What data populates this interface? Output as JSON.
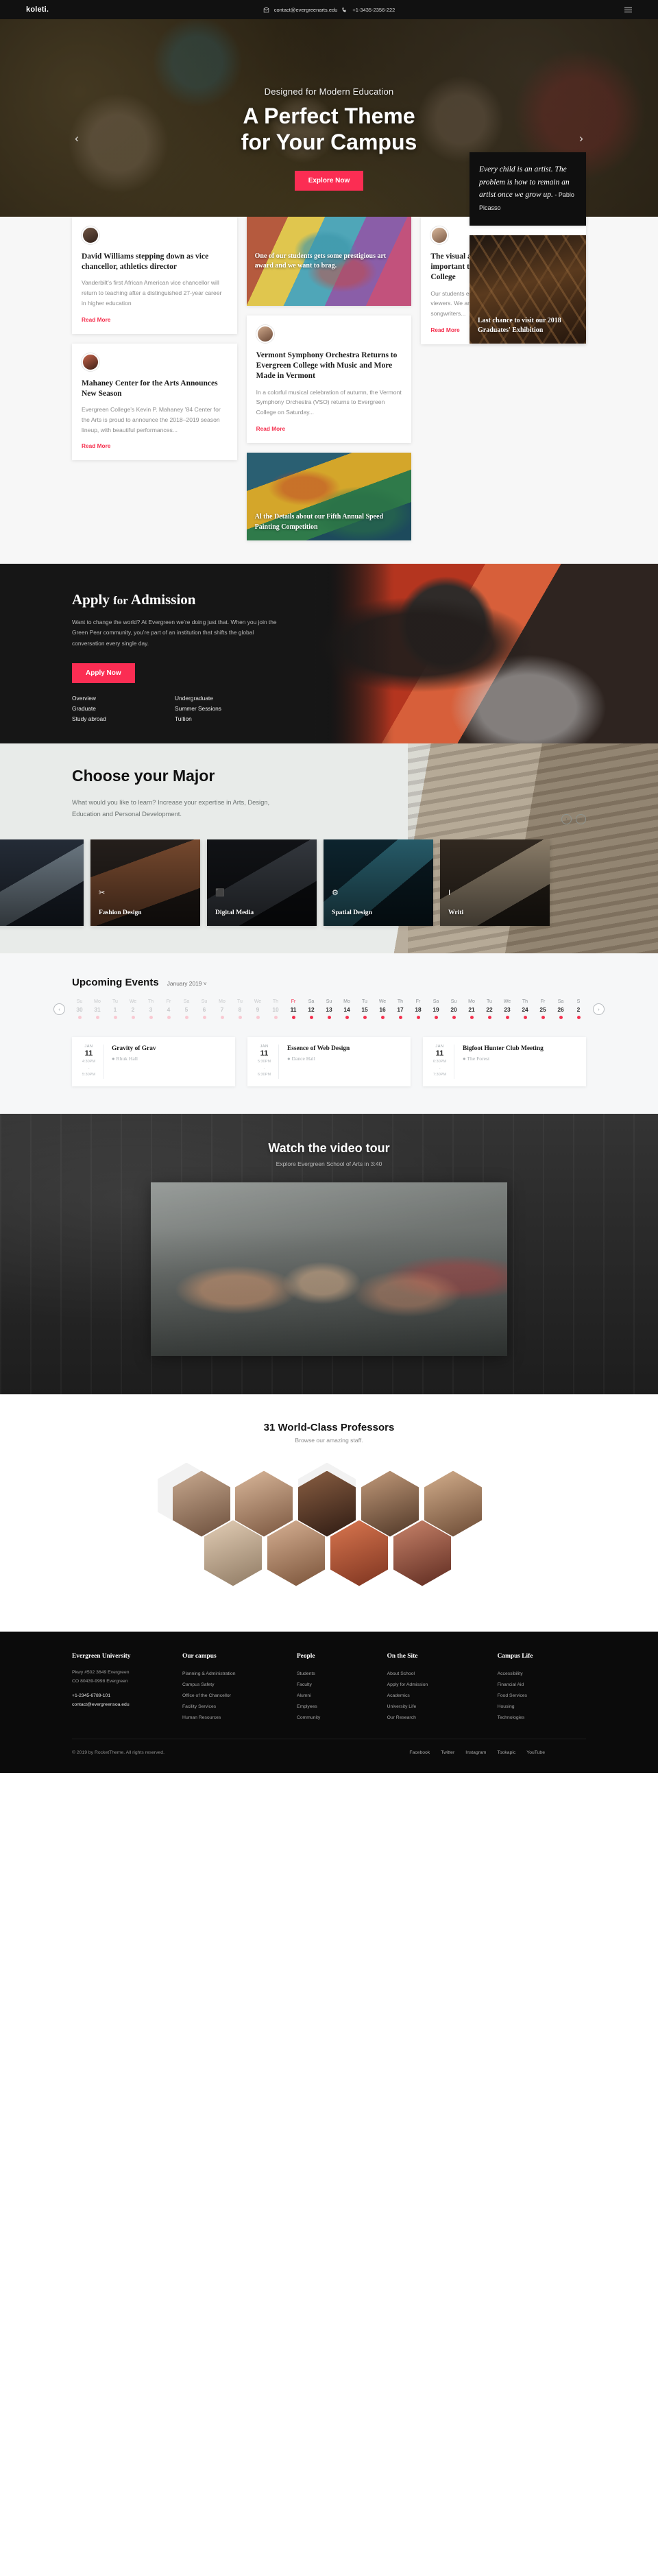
{
  "topbar": {
    "brand": "koleti.",
    "email": "contact@evergreenarts.edu",
    "phone": "+1-3435-2356-222",
    "email_icon": "envelope-icon",
    "phone_icon": "phone-icon",
    "menu_icon": "hamburger-icon"
  },
  "hero": {
    "kicker": "Designed for Modern Education",
    "title_line1": "A Perfect Theme",
    "title_line2": "for Your Campus",
    "cta": "Explore Now",
    "prev": "‹",
    "next": "›"
  },
  "news": {
    "cards": [
      {
        "title": "David Williams stepping down as vice chancellor, athletics director",
        "excerpt": "Vanderbilt’s first African American vice chancellor will return to teaching after a distinguished 27-year career in higher education",
        "link": "Read More"
      },
      {
        "title": "Mahaney Center for the Arts Announces New Season",
        "excerpt": "Evergreen College’s Kevin P. Mahaney ’84 Center for the Arts is proud to announce the 2018–2019 season lineup, with beautiful performances...",
        "link": "Read More"
      },
      {
        "title": "The visual arts are fundamentally important to the life and culture of our College",
        "excerpt": "Our students engage with the arts as both creators and viewers. We are painters and sculptors, actors and songwriters...",
        "link": "Read More"
      },
      {
        "title": "Vermont Symphony Orchestra Returns to Evergreen College with Music and More Made in Vermont",
        "excerpt": "In a colorful musical celebration of autumn, the Vermont Symphony Orchestra (VSO) returns to Evergreen College on Saturday...",
        "link": "Read More"
      }
    ],
    "image_cards": [
      {
        "caption": "One of our students gets some prestigious art award and we want to brag."
      },
      {
        "caption": "Al the Details about our Fifth Annual Speed Painting Competition"
      },
      {
        "caption": "Last chance to visit our 2018 Graduates' Exhibition"
      }
    ],
    "quote": {
      "text": "Every child is an artist. The problem is how to remain an artist once we grow up.",
      "author": " - Pablo Picasso"
    }
  },
  "admission": {
    "title_a": "Apply",
    "title_for": "for",
    "title_b": "Admission",
    "body": "Want to change the world? At Evergreen we’re doing just that. When you join the Green Pear community, you’re part of an institution that shifts the global conversation every single day.",
    "cta": "Apply Now",
    "links": [
      "Overview",
      "Undergraduate",
      "Graduate",
      "Summer Sessions",
      "Study abroad",
      "Tuition"
    ]
  },
  "majors": {
    "title": "Choose your Major",
    "subtitle": "What would you like to learn? Increase your expertise in Arts, Design, Education and Personal Development.",
    "prev": "‹",
    "next": "›",
    "items": [
      {
        "label": "",
        "icon": "palette-icon",
        "glyph": ""
      },
      {
        "label": "Fashion Design",
        "icon": "scissors-icon",
        "glyph": "✂"
      },
      {
        "label": "Digital Media",
        "icon": "monitor-icon",
        "glyph": "⬛"
      },
      {
        "label": "Spatial Design",
        "icon": "compass-icon",
        "glyph": "⚙"
      },
      {
        "label": "Writi",
        "icon": "text-cursor-icon",
        "glyph": "I"
      }
    ]
  },
  "events": {
    "title": "Upcoming Events",
    "month": "January 2019",
    "month_caret": "˅",
    "prev": "‹",
    "next": "›",
    "calendar": [
      {
        "dow": "Su",
        "num": "30",
        "state": "off"
      },
      {
        "dow": "Mo",
        "num": "31",
        "state": "off"
      },
      {
        "dow": "Tu",
        "num": "1",
        "state": "off"
      },
      {
        "dow": "We",
        "num": "2",
        "state": "off"
      },
      {
        "dow": "Th",
        "num": "3",
        "state": "off"
      },
      {
        "dow": "Fr",
        "num": "4",
        "state": "off"
      },
      {
        "dow": "Sa",
        "num": "5",
        "state": "off"
      },
      {
        "dow": "Su",
        "num": "6",
        "state": "off"
      },
      {
        "dow": "Mo",
        "num": "7",
        "state": "off"
      },
      {
        "dow": "Tu",
        "num": "8",
        "state": "off"
      },
      {
        "dow": "We",
        "num": "9",
        "state": "off"
      },
      {
        "dow": "Th",
        "num": "10",
        "state": "off"
      },
      {
        "dow": "Fr",
        "num": "11",
        "state": "active"
      },
      {
        "dow": "Sa",
        "num": "12",
        "state": "on"
      },
      {
        "dow": "Su",
        "num": "13",
        "state": "on"
      },
      {
        "dow": "Mo",
        "num": "14",
        "state": "on"
      },
      {
        "dow": "Tu",
        "num": "15",
        "state": "on"
      },
      {
        "dow": "We",
        "num": "16",
        "state": "on"
      },
      {
        "dow": "Th",
        "num": "17",
        "state": "on"
      },
      {
        "dow": "Fr",
        "num": "18",
        "state": "on"
      },
      {
        "dow": "Sa",
        "num": "19",
        "state": "on"
      },
      {
        "dow": "Su",
        "num": "20",
        "state": "on"
      },
      {
        "dow": "Mo",
        "num": "21",
        "state": "on"
      },
      {
        "dow": "Tu",
        "num": "22",
        "state": "on"
      },
      {
        "dow": "We",
        "num": "23",
        "state": "on"
      },
      {
        "dow": "Th",
        "num": "24",
        "state": "on"
      },
      {
        "dow": "Fr",
        "num": "25",
        "state": "on"
      },
      {
        "dow": "Sa",
        "num": "26",
        "state": "on"
      },
      {
        "dow": "S",
        "num": "2",
        "state": "on"
      }
    ],
    "cards": [
      {
        "month": "JAN",
        "day": "11",
        "start": "4:30PM",
        "dash": "-",
        "end": "5:30PM",
        "title": "Gravity of Grav",
        "location": "Rhuk Hall",
        "pin": "☉"
      },
      {
        "month": "JAN",
        "day": "11",
        "start": "5:30PM",
        "dash": "-",
        "end": "6:30PM",
        "title": "Essence of Web Design",
        "location": "Dance Hall",
        "pin": "☉"
      },
      {
        "month": "JAN",
        "day": "11",
        "start": "6:30PM",
        "dash": "-",
        "end": "7:30PM",
        "title": "Bigfoot Hunter Club Meeting",
        "location": "The Forest",
        "pin": "☉"
      }
    ]
  },
  "video": {
    "title": "Watch the video tour",
    "subtitle": "Explore Evergreen School of Arts in 3:40"
  },
  "professors": {
    "title": "31 World-Class Professors",
    "subtitle": "Browse our amazing staff."
  },
  "footer": {
    "columns": [
      {
        "heading": "Evergreen University",
        "address": "Pkwy #502 3649 Evergreen\nCO 80439-9998 Evergreen",
        "phone": "+1-2345-6789-101",
        "email": "contact@evergreensoa.edu",
        "items": []
      },
      {
        "heading": "Our campus",
        "items": [
          "Planning & Administration",
          "Campus Safety",
          "Office of the Chancellor",
          "Facility Services",
          "Human Resources"
        ]
      },
      {
        "heading": "People",
        "items": [
          "Students",
          "Faculty",
          "Alumni",
          "Emplyees",
          "Community"
        ]
      },
      {
        "heading": "On the Site",
        "items": [
          "About School",
          "Apply for Admission",
          "Academics",
          "University Life",
          "Our Research"
        ]
      },
      {
        "heading": "Campus Life",
        "items": [
          "Accessibility",
          "Financial Aid",
          "Food Services",
          "Housing",
          "Technologies"
        ]
      }
    ],
    "copyright": "© 2019 by RocketTheme. All rights reserved.",
    "socials": [
      "Facebook",
      "Twitter",
      "Instagram",
      "Tookapic",
      "YouTube"
    ]
  },
  "colors": {
    "accent": "#fb2d53",
    "accent_link": "#f5314f",
    "dark": "#111111",
    "footer_bg": "#0b0b0b"
  }
}
